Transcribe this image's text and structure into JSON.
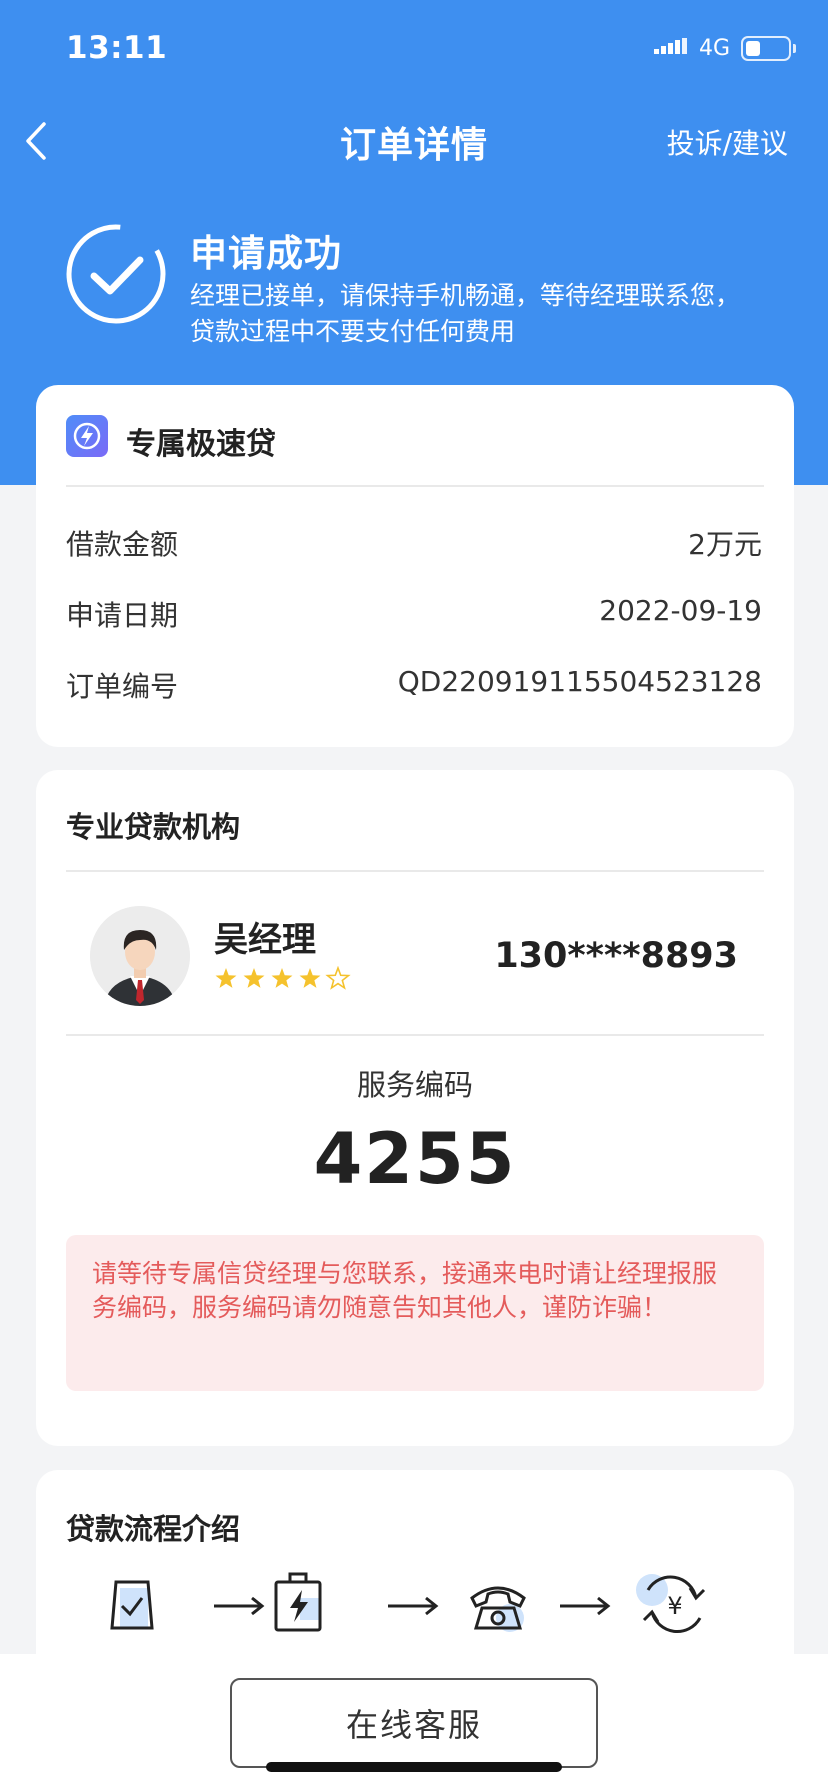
{
  "status_bar": {
    "time": "13:11",
    "network": "4G"
  },
  "nav": {
    "title": "订单详情",
    "right_action": "投诉/建议"
  },
  "success": {
    "title": "申请成功",
    "description": "经理已接单，请保持手机畅通，等待经理联系您，贷款过程中不要支付任何费用"
  },
  "product": {
    "name": "专属极速贷",
    "rows": [
      {
        "label": "借款金额",
        "value": "2万元"
      },
      {
        "label": "申请日期",
        "value": "2022-09-19"
      },
      {
        "label": "订单编号",
        "value": "QD220919115504523128"
      }
    ]
  },
  "institution": {
    "title": "专业贷款机构",
    "manager_name": "吴经理",
    "rating": 4,
    "rating_max": 5,
    "phone": "130****8893",
    "service_label": "服务编码",
    "service_code": "4255",
    "warning": "请等待专属信贷经理与您联系，接通来电时请让经理报服务编码，服务编码请勿随意告知其他人，谨防诈骗！"
  },
  "process": {
    "title": "贷款流程介绍",
    "steps": [
      "apply-form-icon",
      "approval-icon",
      "phone-call-icon",
      "loan-disbursement-icon"
    ]
  },
  "bottom": {
    "customer_service": "在线客服"
  },
  "colors": {
    "primary": "#3e8ff0",
    "warning_bg": "#fcebec",
    "warning_text": "#e45b5b",
    "star": "#f5c22d"
  }
}
